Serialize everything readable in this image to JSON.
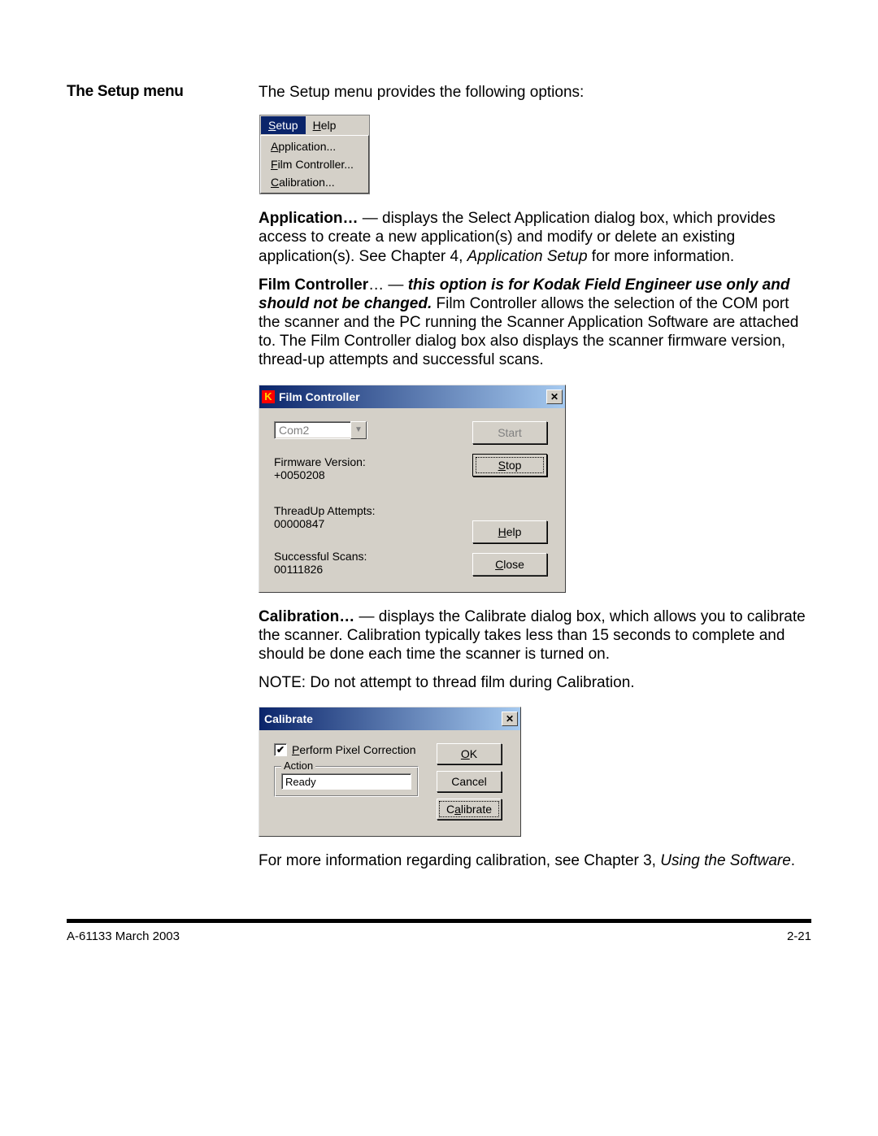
{
  "left_heading": "The Setup menu",
  "intro": "The Setup menu provides the following options:",
  "menu": {
    "bar": {
      "setup": "Setup",
      "help": "Help"
    },
    "items": [
      "Application...",
      "Film Controller...",
      "Calibration..."
    ]
  },
  "application_para_strong": "Application…",
  "application_para": " — displays the Select Application dialog box, which provides access to create a new application(s) and modify or delete an existing application(s).  See Chapter 4, ",
  "application_para_italic": "Application Setup",
  "application_para_tail": " for more information.",
  "film_ctrl_strong1": "Film Controller",
  "film_ctrl_dots": "… — ",
  "film_ctrl_bold_italic": "this option is for Kodak Field Engineer use only and should not be changed.",
  "film_ctrl_tail": " Film Controller allows the selection of the COM port the scanner and the PC running the Scanner Application Software are attached to. The Film Controller dialog box also displays the scanner firmware version, thread-up attempts and successful scans.",
  "film_dialog": {
    "title": "Film Controller",
    "port": "Com2",
    "firmware_label": "Firmware Version:",
    "firmware_value": "+0050208",
    "thread_label": "ThreadUp Attempts:",
    "thread_value": "00000847",
    "scans_label": "Successful Scans:",
    "scans_value": "00111826",
    "buttons": {
      "start": "Start",
      "stop": "Stop",
      "help": "Help",
      "close": "Close"
    }
  },
  "calibration_strong": "Calibration…",
  "calibration_para": " — displays the Calibrate dialog box, which allows you to calibrate the scanner. Calibration typically takes less than 15 seconds to complete and should be done each time the scanner is turned on.",
  "calibration_note": "NOTE: Do not attempt to thread film during Calibration.",
  "calibrate_dialog": {
    "title": "Calibrate",
    "checkbox_label": "Perform Pixel Correction",
    "fieldset_legend": "Action",
    "action_value": "Ready",
    "buttons": {
      "ok": "OK",
      "cancel": "Cancel",
      "calibrate": "Calibrate"
    }
  },
  "more_info_pre": "For more information regarding calibration, see Chapter 3, ",
  "more_info_italic": "Using the Software",
  "more_info_tail": ".",
  "footer": {
    "left": "A-61133  March 2003",
    "right": "2-21"
  }
}
